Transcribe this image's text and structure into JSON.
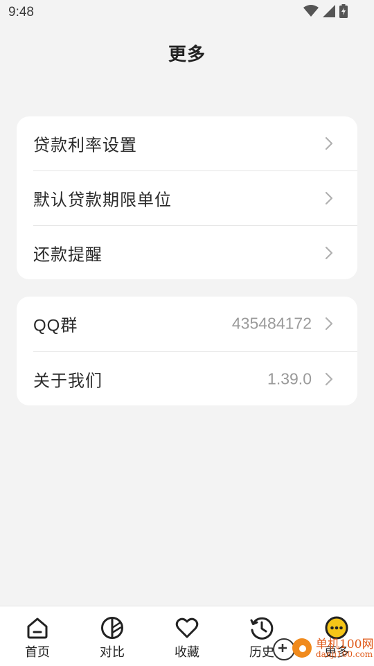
{
  "status_bar": {
    "time": "9:48"
  },
  "header": {
    "title": "更多"
  },
  "settings_card": {
    "items": [
      {
        "label": "贷款利率设置"
      },
      {
        "label": "默认贷款期限单位"
      },
      {
        "label": "还款提醒"
      }
    ]
  },
  "info_card": {
    "items": [
      {
        "label": "QQ群",
        "value": "435484172"
      },
      {
        "label": "关于我们",
        "value": "1.39.0"
      }
    ]
  },
  "bottom_nav": {
    "items": [
      {
        "label": "首页",
        "icon": "home-icon"
      },
      {
        "label": "对比",
        "icon": "compare-icon"
      },
      {
        "label": "收藏",
        "icon": "heart-icon"
      },
      {
        "label": "历史",
        "icon": "history-icon"
      },
      {
        "label": "更多",
        "icon": "more-icon",
        "active": true
      }
    ],
    "active_color": "#f5c518"
  },
  "watermark": {
    "text": "单机100网",
    "subtext": "danji100.com"
  }
}
